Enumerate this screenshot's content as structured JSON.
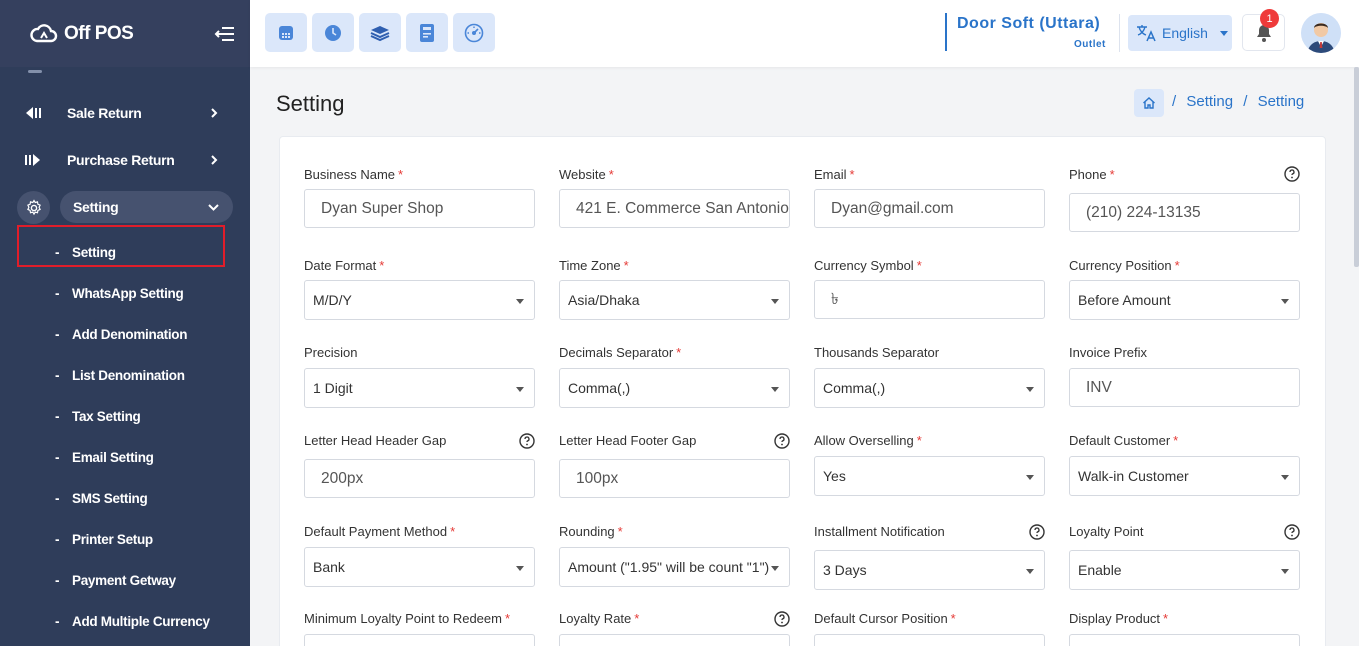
{
  "app": {
    "logo_text": "Off POS"
  },
  "sidebar": {
    "items": [
      {
        "label": "Sale Return"
      },
      {
        "label": "Purchase Return"
      }
    ],
    "setting": {
      "label": "Setting"
    },
    "sub_items": [
      {
        "label": "Setting"
      },
      {
        "label": "WhatsApp Setting"
      },
      {
        "label": "Add Denomination"
      },
      {
        "label": "List Denomination"
      },
      {
        "label": "Tax Setting"
      },
      {
        "label": "Email Setting"
      },
      {
        "label": "SMS Setting"
      },
      {
        "label": "Printer Setup"
      },
      {
        "label": "Payment Getway"
      },
      {
        "label": "Add Multiple Currency"
      }
    ],
    "dash": "-"
  },
  "header": {
    "outlet_name": "Door Soft (Uttara)",
    "outlet_sub": "Outlet",
    "language": "English",
    "notification_count": "1"
  },
  "page": {
    "title": "Setting",
    "breadcrumb": [
      "/",
      "Setting",
      "/",
      "Setting"
    ]
  },
  "form": {
    "business_name": {
      "label": "Business Name",
      "value": "Dyan Super Shop",
      "req": "*"
    },
    "website": {
      "label": "Website",
      "value": "421 E. Commerce San Antonio",
      "req": "*"
    },
    "email": {
      "label": "Email",
      "value": "Dyan@gmail.com",
      "req": "*"
    },
    "phone": {
      "label": "Phone",
      "value": "(210) 224-13135",
      "req": "*"
    },
    "date_format": {
      "label": "Date Format",
      "value": "M/D/Y",
      "req": "*"
    },
    "time_zone": {
      "label": "Time Zone",
      "value": "Asia/Dhaka",
      "req": "*"
    },
    "currency_symbol": {
      "label": "Currency Symbol",
      "value": "৳",
      "req": "*"
    },
    "currency_position": {
      "label": "Currency Position",
      "value": "Before Amount",
      "req": "*"
    },
    "precision": {
      "label": "Precision",
      "value": "1 Digit"
    },
    "decimals_separator": {
      "label": "Decimals Separator",
      "value": "Comma(,)",
      "req": "*"
    },
    "thousands_separator": {
      "label": "Thousands Separator",
      "value": "Comma(,)"
    },
    "invoice_prefix": {
      "label": "Invoice Prefix",
      "value": "INV"
    },
    "lh_header_gap": {
      "label": "Letter Head Header Gap",
      "value": "200px"
    },
    "lh_footer_gap": {
      "label": "Letter Head Footer Gap",
      "value": "100px"
    },
    "allow_overselling": {
      "label": "Allow Overselling",
      "value": "Yes",
      "req": "*"
    },
    "default_customer": {
      "label": "Default Customer",
      "value": "Walk-in Customer",
      "req": "*"
    },
    "default_payment": {
      "label": "Default Payment Method",
      "value": "Bank",
      "req": "*"
    },
    "rounding": {
      "label": "Rounding",
      "value": "Amount (\"1.95\" will be count \"1\")",
      "req": "*"
    },
    "installment_notification": {
      "label": "Installment Notification",
      "value": "3 Days"
    },
    "loyalty_point": {
      "label": "Loyalty Point",
      "value": "Enable"
    },
    "min_loyalty": {
      "label": "Minimum Loyalty Point to Redeem",
      "req": "*"
    },
    "loyalty_rate": {
      "label": "Loyalty Rate",
      "req": "*"
    },
    "default_cursor": {
      "label": "Default Cursor Position",
      "req": "*"
    },
    "display_product": {
      "label": "Display Product",
      "req": "*"
    }
  },
  "colors": {
    "accent": "#2a74c9",
    "sidebar": "#2f3d5a",
    "highlight": "#e11d2a"
  }
}
